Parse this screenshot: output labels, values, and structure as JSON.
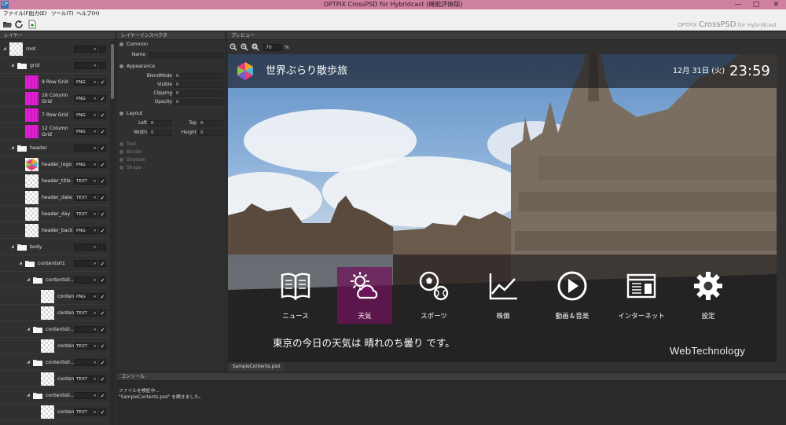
{
  "window": {
    "title": "OPTPiX CrossPSD for Hybridcast (機能評価版)",
    "app_icon_text": "CP",
    "min_glyph": "—",
    "max_glyph": "□",
    "close_glyph": "✕"
  },
  "menu": [
    {
      "label": "ファイル(F)"
    },
    {
      "label": "出力(E)"
    },
    {
      "label": "ツール(T)"
    },
    {
      "label": "ヘルプ(H)"
    }
  ],
  "toolbar": {
    "icons": [
      "folder-open-icon",
      "refresh-icon",
      "export-document-icon"
    ]
  },
  "brand": {
    "prefix": "OPTPiX ",
    "name": "CrossPSD",
    "suffix": " for Hybridcast"
  },
  "layers_panel": {
    "title": "レイヤー",
    "rows": [
      {
        "name": "root",
        "indent": 0,
        "kind": "checker",
        "type": "",
        "checked": false
      },
      {
        "name": "grid",
        "indent": 1,
        "kind": "folder",
        "type": "",
        "checked": false
      },
      {
        "name": "9 Row Grid",
        "indent": 2,
        "kind": "magenta",
        "type": "PNG",
        "checked": true
      },
      {
        "name": "16 Column Grid",
        "indent": 2,
        "kind": "magenta",
        "type": "PNG",
        "checked": true
      },
      {
        "name": "7 Row Grid",
        "indent": 2,
        "kind": "magenta",
        "type": "PNG",
        "checked": true
      },
      {
        "name": "12 Column Grid",
        "indent": 2,
        "kind": "magenta",
        "type": "PNG",
        "checked": true
      },
      {
        "name": "header",
        "indent": 1,
        "kind": "folder",
        "type": "",
        "checked": true
      },
      {
        "name": "header_logo",
        "indent": 2,
        "kind": "logo",
        "type": "PNG",
        "checked": true
      },
      {
        "name": "header_title",
        "indent": 2,
        "kind": "checker",
        "type": "TEXT",
        "checked": true
      },
      {
        "name": "header_date",
        "indent": 2,
        "kind": "checker",
        "type": "TEXT",
        "checked": true
      },
      {
        "name": "header_day",
        "indent": 2,
        "kind": "checker",
        "type": "TEXT",
        "checked": true
      },
      {
        "name": "header_back",
        "indent": 2,
        "kind": "checker",
        "type": "PNG",
        "checked": true
      },
      {
        "name": "body",
        "indent": 1,
        "kind": "folder",
        "type": "",
        "checked": false
      },
      {
        "name": "contents01",
        "indent": 2,
        "kind": "folder",
        "type": "",
        "checked": true
      },
      {
        "name": "contents0...",
        "indent": 3,
        "kind": "folder",
        "type": "",
        "checked": true
      },
      {
        "name": "content...",
        "indent": 4,
        "kind": "checker",
        "type": "PNG",
        "checked": true
      },
      {
        "name": "content...",
        "indent": 4,
        "kind": "checker",
        "type": "TEXT",
        "checked": true
      },
      {
        "name": "contents0...",
        "indent": 3,
        "kind": "folder",
        "type": "",
        "checked": true
      },
      {
        "name": "conten...",
        "indent": 4,
        "kind": "checker",
        "type": "TEXT",
        "checked": true
      },
      {
        "name": "contents0...",
        "indent": 3,
        "kind": "folder",
        "type": "",
        "checked": true
      },
      {
        "name": "conten...",
        "indent": 4,
        "kind": "checker",
        "type": "TEXT",
        "checked": true
      },
      {
        "name": "contents0...",
        "indent": 3,
        "kind": "folder",
        "type": "",
        "checked": true
      },
      {
        "name": "conten...",
        "indent": 4,
        "kind": "checker",
        "type": "TEXT",
        "checked": true
      }
    ]
  },
  "inspector": {
    "title": "レイヤーインスペクタ",
    "common": "Common",
    "name_label": "Name",
    "name_value": "",
    "appearance": "Appearance",
    "blend_label": "BlendMode",
    "blend_value": "0",
    "visible_label": "Visible",
    "visible_value": "0",
    "clipping_label": "Clipping",
    "clipping_value": "0",
    "opacity_label": "Opacity",
    "opacity_value": "0",
    "layout": "Layout",
    "left_label": "Left",
    "left_value": "0",
    "top_label": "Top",
    "top_value": "0",
    "width_label": "Width",
    "width_value": "0",
    "height_label": "Height",
    "height_value": "0",
    "text": "Text",
    "border": "Border",
    "shadow": "Shadow",
    "shape": "Shape"
  },
  "preview": {
    "title": "プレビュー",
    "zoom_value": "70",
    "zoom_unit": "%",
    "file_tab": "SampleContents.psd",
    "screen": {
      "title": "世界ぶらり散歩旅",
      "date": "12月 31日 (火)",
      "time": "23:59",
      "tiles": [
        {
          "label": "ニュース",
          "icon": "book-icon",
          "selected": false
        },
        {
          "label": "天気",
          "icon": "weather-icon",
          "selected": true
        },
        {
          "label": "スポーツ",
          "icon": "sports-balls-icon",
          "selected": false
        },
        {
          "label": "株価",
          "icon": "stock-chart-icon",
          "selected": false
        },
        {
          "label": "動画＆音楽",
          "icon": "play-icon",
          "selected": false
        },
        {
          "label": "インターネット",
          "icon": "browser-icon",
          "selected": false
        },
        {
          "label": "設定",
          "icon": "gear-icon",
          "selected": false
        }
      ],
      "weather_prefix": "東京の今日の天気は ",
      "weather_value": "晴れのち曇り",
      "weather_suffix": " です。",
      "corner_logo": "WebTechnology"
    }
  },
  "console": {
    "title": "コンソール",
    "lines": [
      "ファイルを検証中...",
      "\"SampleContents.psd\" を開きました。"
    ]
  }
}
